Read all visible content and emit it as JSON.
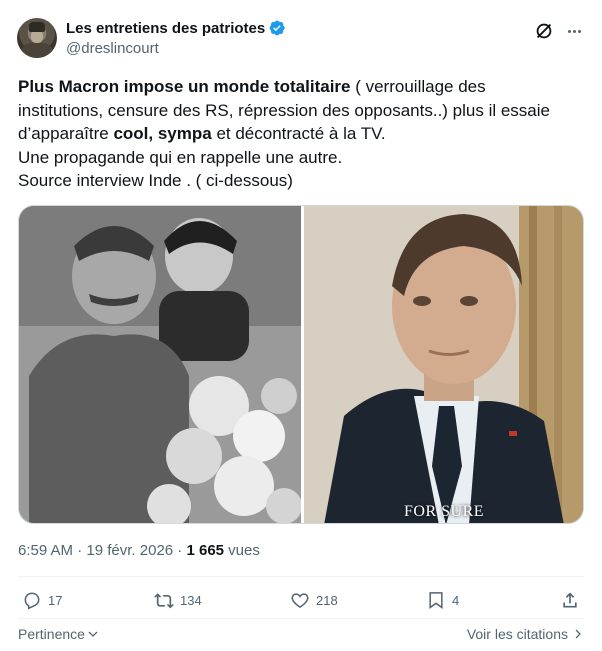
{
  "author": {
    "display_name": "Les entretiens des patriotes",
    "handle": "@dreslincourt",
    "verified": true
  },
  "tweet": {
    "lines": [
      {
        "bold": "Plus Macron impose un monde totalitaire",
        "rest": " ( verrouillage des"
      },
      {
        "text": "institutions, censure des RS, répression des opposants..) plus il essaie"
      },
      {
        "pre": "d’apparaître ",
        "bold": "cool, sympa",
        "rest": " et décontracté à la TV."
      },
      {
        "text": "Une propagande qui en rappelle une autre."
      },
      {
        "text": "Source interview Inde . ( ci-dessous)"
      }
    ]
  },
  "media": {
    "caption": "FOR SURE"
  },
  "meta": {
    "time": "6:59 AM",
    "separator": " · ",
    "date": "19 févr. 2026",
    "separator2": " · ",
    "views_count": "1 665",
    "views_label": " vues"
  },
  "actions": {
    "replies": "17",
    "retweets": "134",
    "likes": "218",
    "bookmarks": "4"
  },
  "footer": {
    "relevance": "Pertinence",
    "quotes": "Voir les citations"
  },
  "colors": {
    "text": "#0f1419",
    "secondary": "#536471",
    "verified": "#1d9bf0",
    "divider": "#eff3f4"
  }
}
